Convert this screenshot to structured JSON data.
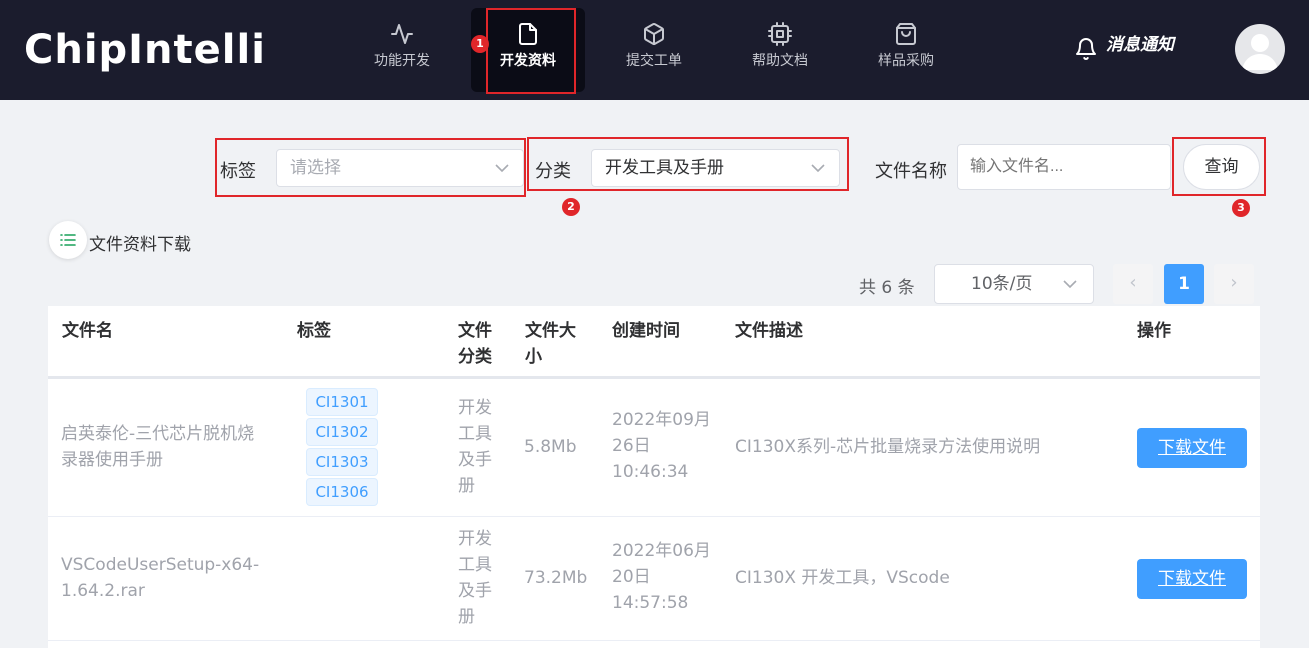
{
  "brand": {
    "logo_text": "ChipIntelli"
  },
  "nav": {
    "items": [
      {
        "label": "功能开发",
        "icon": "activity-icon"
      },
      {
        "label": "开发资料",
        "icon": "file-icon",
        "active": true
      },
      {
        "label": "提交工单",
        "icon": "box-icon"
      },
      {
        "label": "帮助文档",
        "icon": "chip-icon"
      },
      {
        "label": "样品采购",
        "icon": "shopping-bag-icon"
      }
    ],
    "notification_label": "消息通知"
  },
  "annotations": {
    "one": "1",
    "two": "2",
    "three": "3"
  },
  "filters": {
    "tag_label": "标签",
    "tag_placeholder": "请选择",
    "category_label": "分类",
    "category_value": "开发工具及手册",
    "filename_label": "文件名称",
    "filename_placeholder": "输入文件名...",
    "query_button": "查询"
  },
  "section": {
    "title": "文件资料下载",
    "icon": "list-icon"
  },
  "pagination": {
    "total_text": "共 6 条",
    "page_size": "10条/页",
    "current_page": "1",
    "prev": "‹",
    "next": "›"
  },
  "table": {
    "headers": {
      "name": "文件名",
      "tags": "标签",
      "category": [
        "文件",
        "分类"
      ],
      "size": [
        "文件大",
        "小"
      ],
      "created": "创建时间",
      "desc": "文件描述",
      "action": "操作"
    },
    "rows": [
      {
        "name": [
          "启英泰伦-三代芯片脱机烧",
          "录器使用手册"
        ],
        "tags": [
          "CI1301",
          "CI1302",
          "CI1303",
          "CI1306"
        ],
        "category": [
          "开发",
          "工具",
          "及手",
          "册"
        ],
        "size": "5.8Mb",
        "created": [
          "2022年09月",
          "26日",
          "10:46:34"
        ],
        "desc": "CI130X系列-芯片批量烧录方法使用说明",
        "action": "下载文件"
      },
      {
        "name": [
          "VSCodeUserSetup-x64-",
          "1.64.2.rar"
        ],
        "tags": [],
        "category": [
          "开发",
          "工具",
          "及手",
          "册"
        ],
        "size": "73.2Mb",
        "created": [
          "2022年06月",
          "20日",
          "14:57:58"
        ],
        "desc": "CI130X 开发工具，VScode",
        "action": "下载文件"
      }
    ]
  },
  "colors": {
    "nav_bg": "#1b1c2d",
    "accent": "#409eff",
    "highlight": "#e0262a",
    "page_bg": "#f0f2f5"
  }
}
